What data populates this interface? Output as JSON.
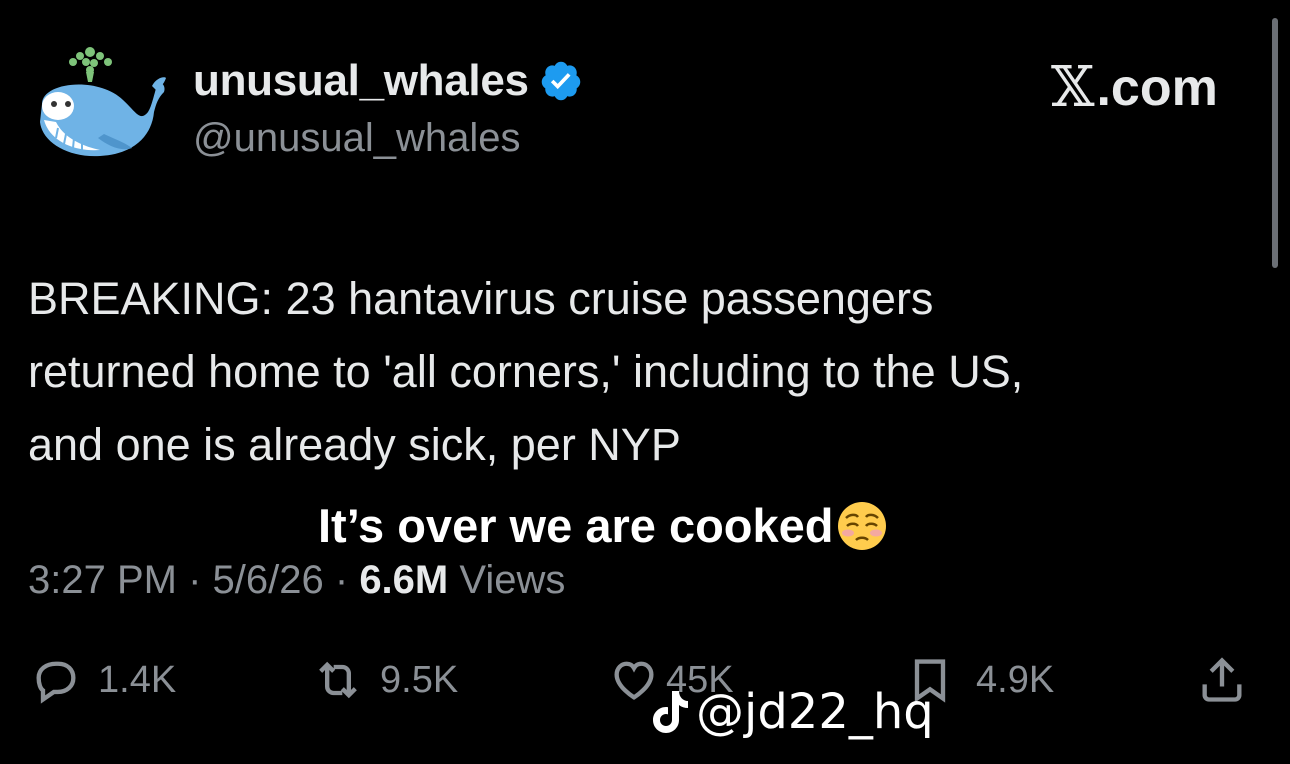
{
  "author": {
    "display_name": "unusual_whales",
    "handle": "@unusual_whales",
    "avatar_icon": "whale-icon",
    "verified_icon": "verified-badge-icon"
  },
  "brand": {
    "label": ".com",
    "icon": "x-logo-icon"
  },
  "tweet": {
    "lines": [
      "BREAKING: 23 hantavirus cruise passengers",
      "returned home to 'all corners,' including to the US,",
      "and one is already sick, per NYP"
    ]
  },
  "caption": {
    "text": "It’s over we are cooked",
    "emoji": "pleading-face-emoji"
  },
  "meta": {
    "time": "3:27 PM",
    "date": "5/6/26",
    "views_count": "6.6M",
    "views_label": "Views"
  },
  "actions": {
    "replies": "1.4K",
    "reposts": "9.5K",
    "likes": "45K",
    "bookmarks": "4.9K"
  },
  "watermark": {
    "text": "@jd22_hq",
    "icon": "tiktok-icon"
  },
  "colors": {
    "background": "#000000",
    "text": "#e7e9ea",
    "secondary": "#8b9096",
    "verified": "#1d9bf0",
    "avatar_blue": "#6fb3e6"
  }
}
